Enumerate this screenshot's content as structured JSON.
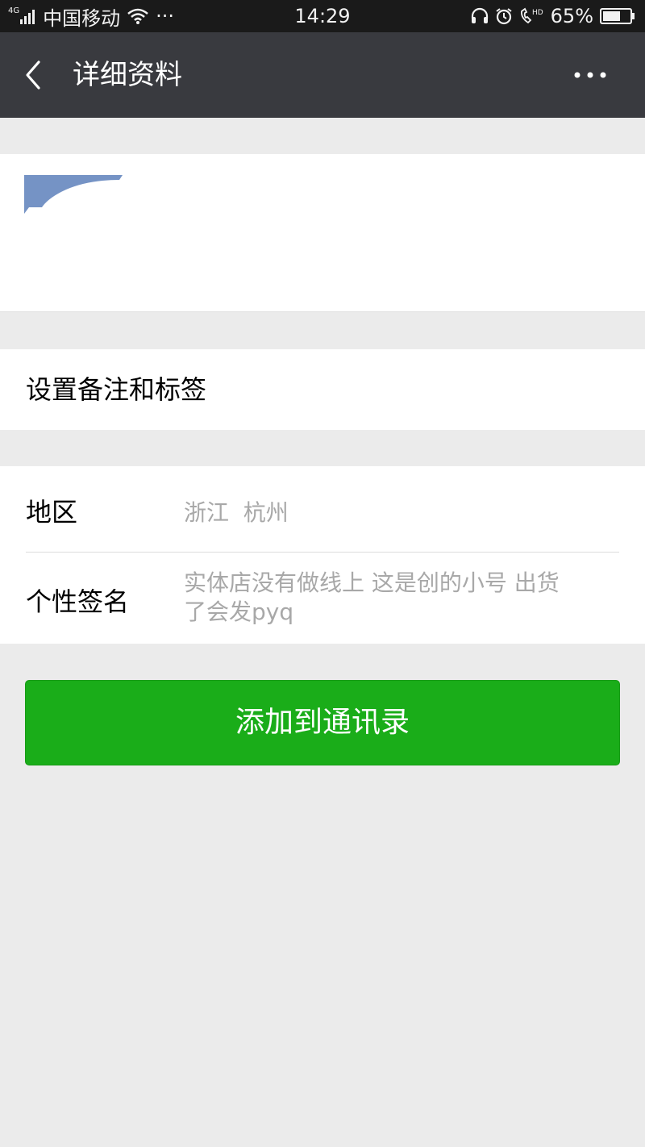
{
  "status_bar": {
    "network": "4G",
    "carrier": "中国移动",
    "more": "···",
    "time": "14:29",
    "hd": "HD",
    "battery_level": 0.65,
    "battery": "65%"
  },
  "nav": {
    "title": "详细资料"
  },
  "profile": {
    "avatar_colors": [
      "#7593c5",
      "#ffffff"
    ]
  },
  "remark": {
    "label": "设置备注和标签"
  },
  "info": {
    "region_label": "地区",
    "region_value": "浙江  杭州",
    "signature_label": "个性签名",
    "signature_line1": "实体店没有做线上 这是创的小号 出货",
    "signature_line2": "了会发pyq"
  },
  "actions": {
    "add_contact": "添加到通讯录"
  },
  "colors": {
    "status_bar": "#1a1a1a",
    "nav_bar": "#393a3f",
    "background": "#ebebeb",
    "primary_button": "#1aad19",
    "secondary_text": "#a8a8a8"
  }
}
